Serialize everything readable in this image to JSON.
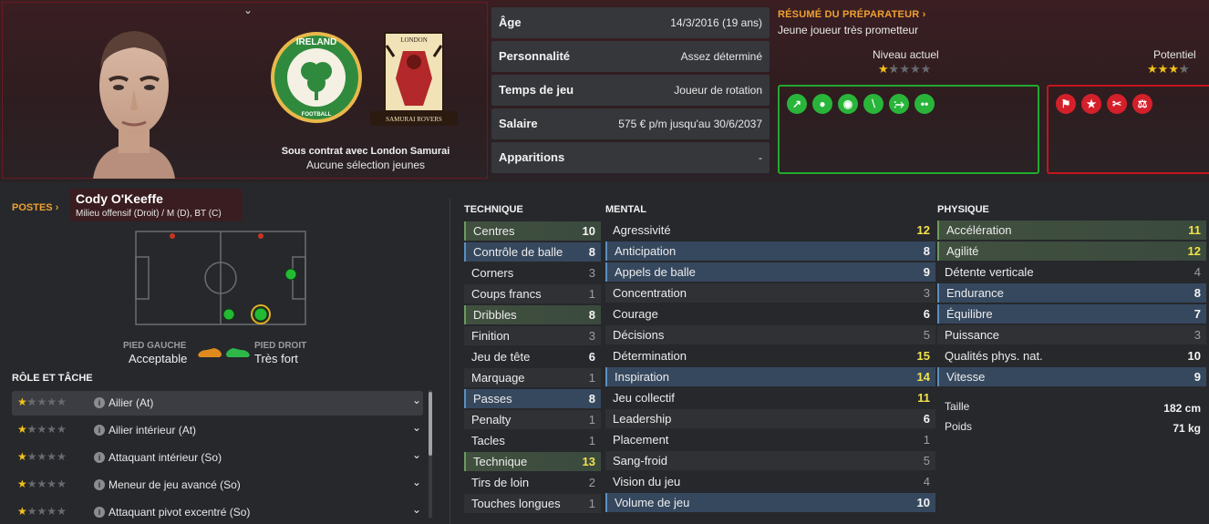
{
  "player": {
    "name": "Cody O'Keeffe",
    "positions_text": "Milieu offensif (Droit) / M (D), BT (C)",
    "contract_text": "Sous contrat avec London Samurai",
    "youth_caps_text": "Aucune sélection jeunes",
    "nation_badge_text": "IRELAND",
    "nation_badge_sub": "FOOTBALL",
    "club_badge_top": "LONDON",
    "club_badge_bottom": "SAMURAI ROVERS"
  },
  "info": [
    {
      "label": "Âge",
      "value": "14/3/2016 (19 ans)"
    },
    {
      "label": "Personnalité",
      "value": "Assez déterminé"
    },
    {
      "label": "Temps de jeu",
      "value": "Joueur de rotation"
    },
    {
      "label": "Salaire",
      "value": "575 € p/m jusqu'au 30/6/2037"
    },
    {
      "label": "Apparitions",
      "value": "-"
    }
  ],
  "coach": {
    "title": "RÉSUMÉ DU PRÉPARATEUR",
    "summary": "Jeune joueur très prometteur",
    "current_label": "Niveau actuel",
    "current_stars": 1.5,
    "potential_label": "Potentiel",
    "potential_stars": 3.5
  },
  "traits": {
    "good": [
      "trend-up-icon",
      "brain-icon",
      "target-icon",
      "bandage-icon",
      "syringe-icon",
      "pills-icon"
    ],
    "bad": [
      "flag-icon",
      "star-icon",
      "scissors-icon",
      "flask-icon"
    ]
  },
  "labels": {
    "postes": "POSTES",
    "pied_gauche": "PIED GAUCHE",
    "pied_gauche_val": "Acceptable",
    "pied_droit": "PIED DROIT",
    "pied_droit_val": "Très fort",
    "role_title": "RÔLE ET TÂCHE",
    "technique": "TECHNIQUE",
    "mental": "MENTAL",
    "physique": "PHYSIQUE",
    "taille": "Taille",
    "taille_val": "182 cm",
    "poids": "Poids",
    "poids_val": "71 kg"
  },
  "roles": [
    {
      "name": "Ailier (At)",
      "stars": 1.5
    },
    {
      "name": "Ailier intérieur (At)",
      "stars": 1.5
    },
    {
      "name": "Attaquant intérieur (So)",
      "stars": 1
    },
    {
      "name": "Meneur de jeu avancé (So)",
      "stars": 1
    },
    {
      "name": "Attaquant pivot excentré (So)",
      "stars": 1
    }
  ],
  "technique": [
    {
      "name": "Centres",
      "value": "10",
      "hl": "green"
    },
    {
      "name": "Contrôle de balle",
      "value": "8",
      "hl": "blue"
    },
    {
      "name": "Corners",
      "value": "3",
      "hl": ""
    },
    {
      "name": "Coups francs",
      "value": "1",
      "hl": ""
    },
    {
      "name": "Dribbles",
      "value": "8",
      "hl": "green"
    },
    {
      "name": "Finition",
      "value": "3",
      "hl": ""
    },
    {
      "name": "Jeu de tête",
      "value": "6",
      "hl": ""
    },
    {
      "name": "Marquage",
      "value": "1",
      "hl": ""
    },
    {
      "name": "Passes",
      "value": "8",
      "hl": "blue"
    },
    {
      "name": "Penalty",
      "value": "1",
      "hl": ""
    },
    {
      "name": "Tacles",
      "value": "1",
      "hl": ""
    },
    {
      "name": "Technique",
      "value": "13",
      "hl": "green"
    },
    {
      "name": "Tirs de loin",
      "value": "2",
      "hl": ""
    },
    {
      "name": "Touches longues",
      "value": "1",
      "hl": ""
    }
  ],
  "mental": [
    {
      "name": "Agressivité",
      "value": "12",
      "hl": ""
    },
    {
      "name": "Anticipation",
      "value": "8",
      "hl": "blue"
    },
    {
      "name": "Appels de balle",
      "value": "9",
      "hl": "blue"
    },
    {
      "name": "Concentration",
      "value": "3",
      "hl": ""
    },
    {
      "name": "Courage",
      "value": "6",
      "hl": ""
    },
    {
      "name": "Décisions",
      "value": "5",
      "hl": ""
    },
    {
      "name": "Détermination",
      "value": "15",
      "hl": ""
    },
    {
      "name": "Inspiration",
      "value": "14",
      "hl": "blue"
    },
    {
      "name": "Jeu collectif",
      "value": "11",
      "hl": ""
    },
    {
      "name": "Leadership",
      "value": "6",
      "hl": ""
    },
    {
      "name": "Placement",
      "value": "1",
      "hl": ""
    },
    {
      "name": "Sang-froid",
      "value": "5",
      "hl": ""
    },
    {
      "name": "Vision du jeu",
      "value": "4",
      "hl": ""
    },
    {
      "name": "Volume de jeu",
      "value": "10",
      "hl": "blue"
    }
  ],
  "physique": [
    {
      "name": "Accélération",
      "value": "11",
      "hl": "green"
    },
    {
      "name": "Agilité",
      "value": "12",
      "hl": "green"
    },
    {
      "name": "Détente verticale",
      "value": "4",
      "hl": ""
    },
    {
      "name": "Endurance",
      "value": "8",
      "hl": "blue"
    },
    {
      "name": "Équilibre",
      "value": "7",
      "hl": "blue"
    },
    {
      "name": "Puissance",
      "value": "3",
      "hl": ""
    },
    {
      "name": "Qualités phys. nat.",
      "value": "10",
      "hl": ""
    },
    {
      "name": "Vitesse",
      "value": "9",
      "hl": "blue"
    }
  ],
  "colors": {
    "accent_orange": "#f0a030",
    "good_green": "#22a92f",
    "bad_red": "#c4161c",
    "value_yellow": "#f2e24a"
  }
}
